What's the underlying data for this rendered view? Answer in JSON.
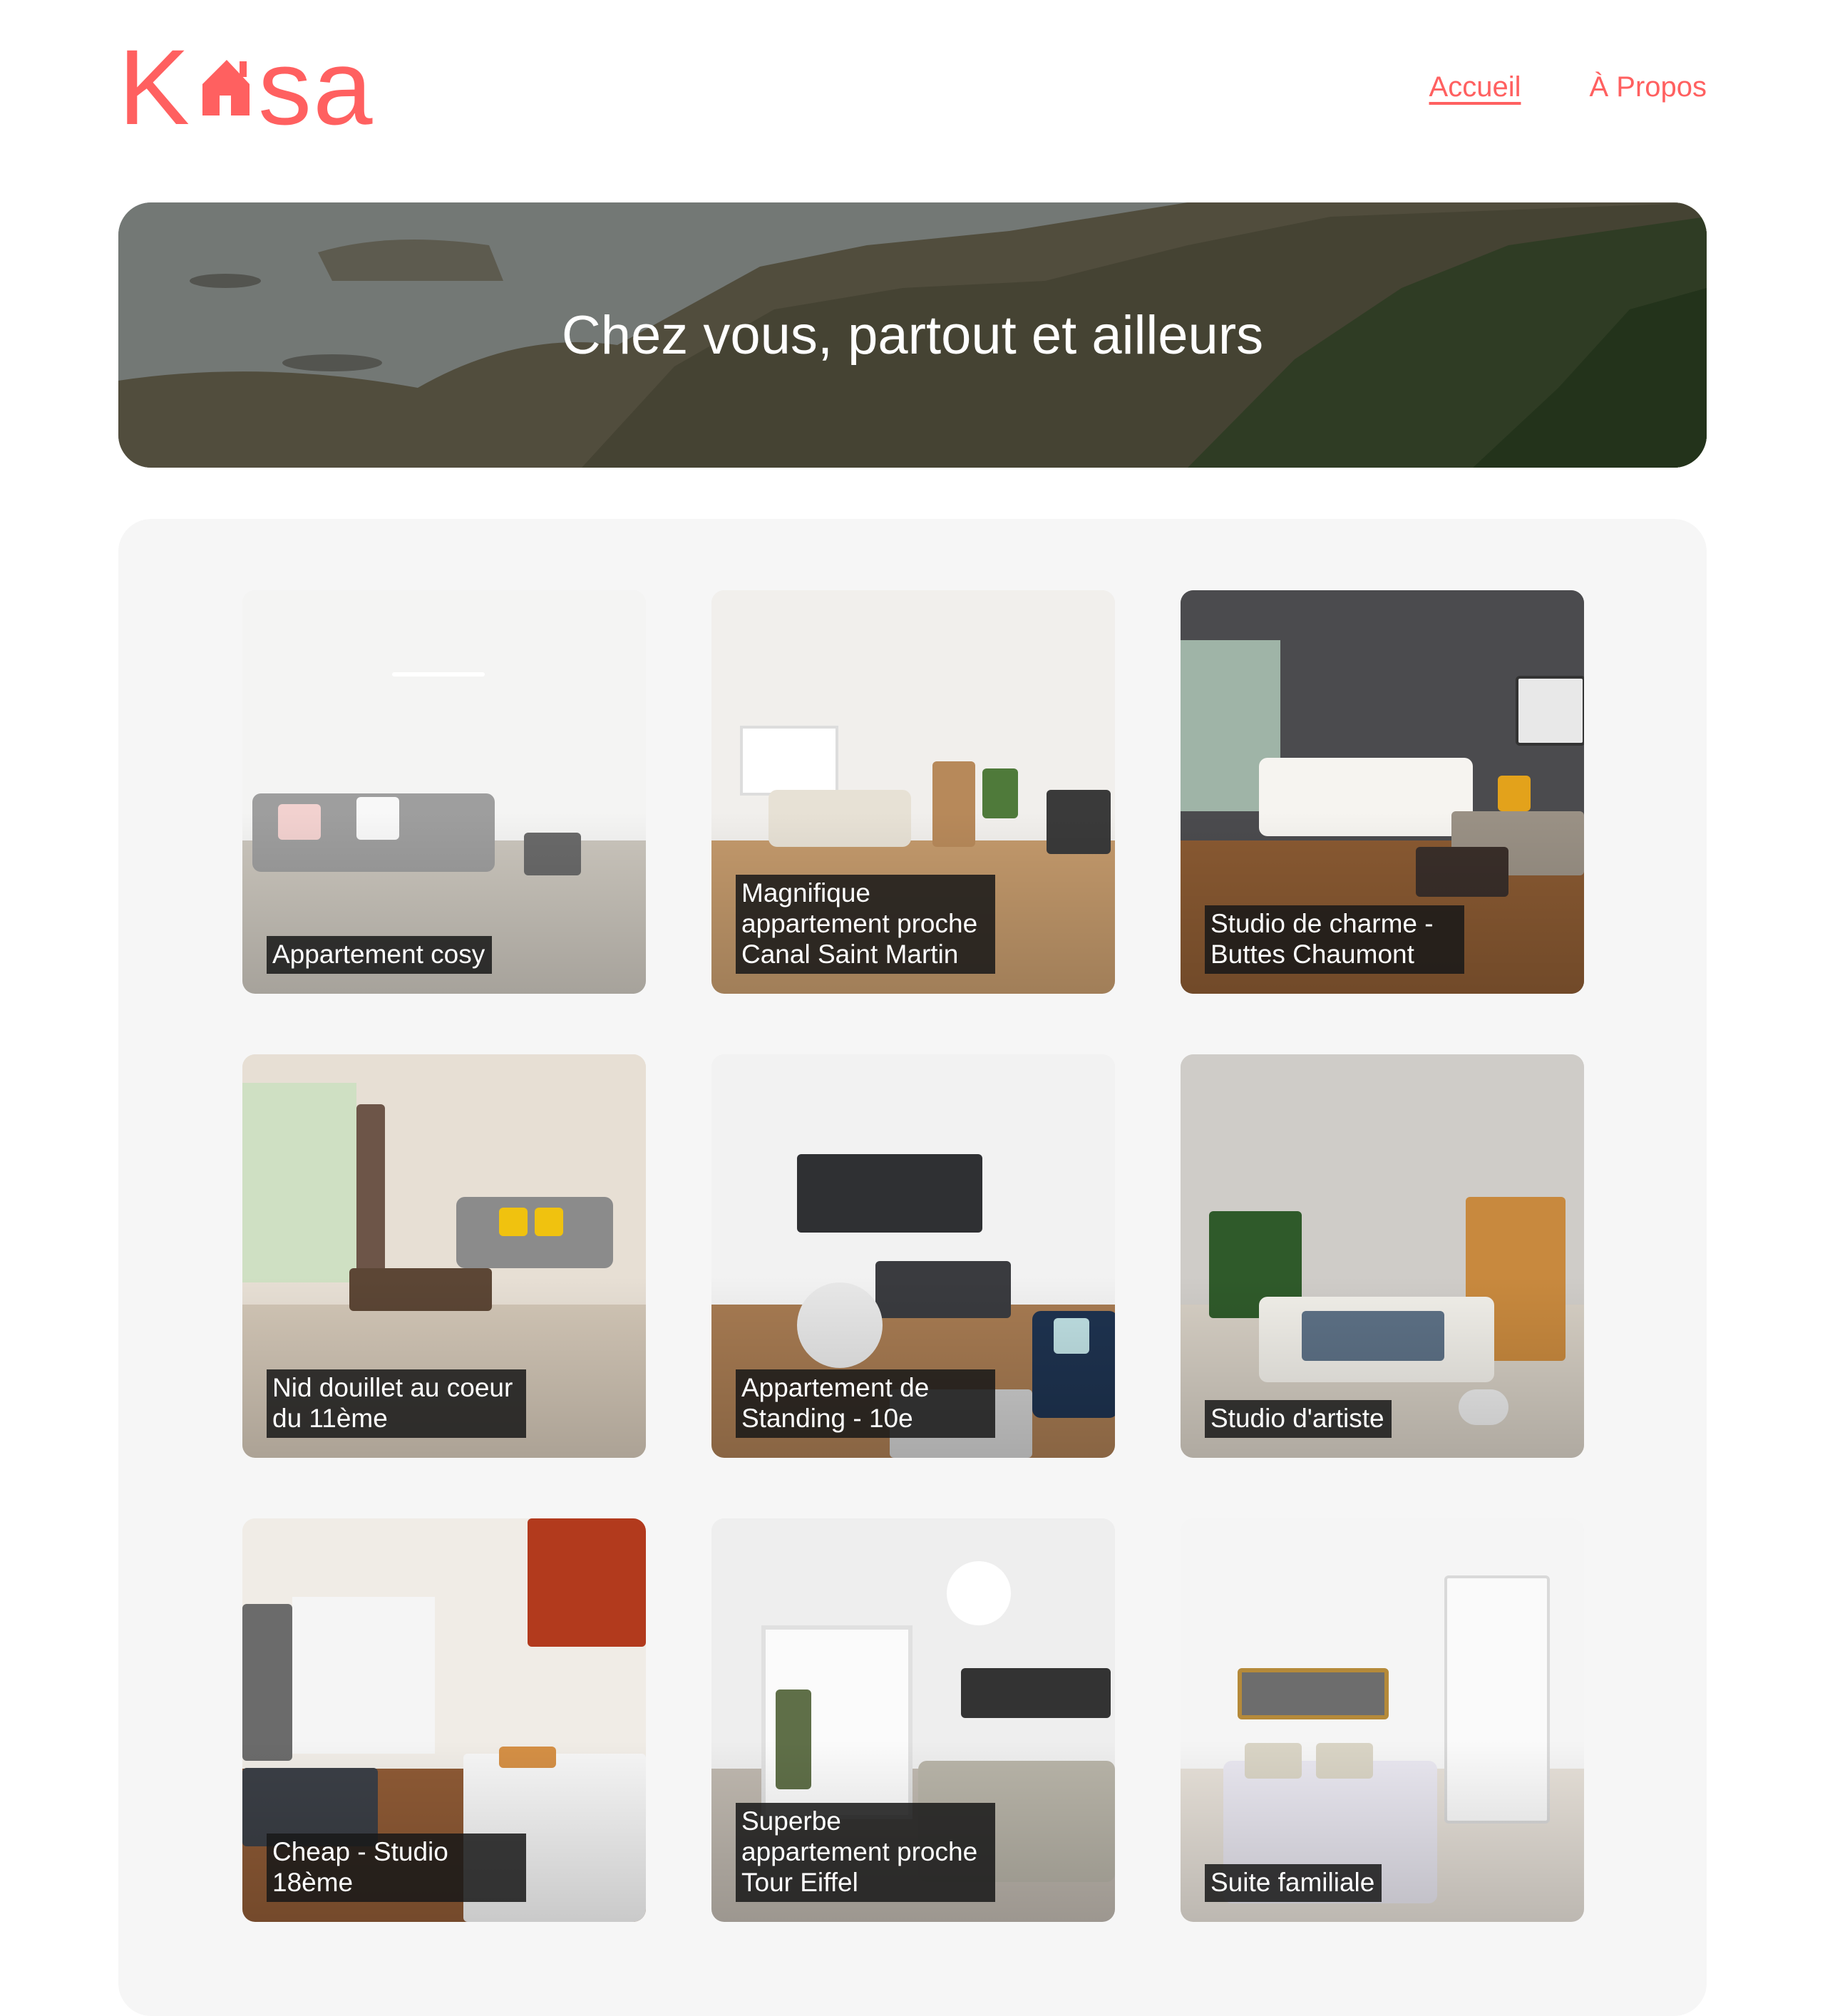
{
  "header": {
    "logo": {
      "letters_left": "K",
      "letters_right": "sa",
      "icon": "house-icon"
    },
    "nav": [
      {
        "label": "Accueil",
        "active": true
      },
      {
        "label": "À Propos",
        "active": false
      }
    ]
  },
  "banner": {
    "title": "Chez vous, partout et ailleurs"
  },
  "gallery": {
    "cards": [
      {
        "title": "Appartement cosy"
      },
      {
        "title": "Magnifique appartement proche Canal Saint Martin"
      },
      {
        "title": "Studio de charme - Buttes Chaumont"
      },
      {
        "title": "Nid douillet au coeur du 11ème"
      },
      {
        "title": "Appartement de Standing - 10e"
      },
      {
        "title": "Studio d'artiste"
      },
      {
        "title": "Cheap - Studio 18ème"
      },
      {
        "title": "Superbe appartement proche Tour Eiffel"
      },
      {
        "title": "Suite familiale"
      }
    ]
  },
  "colors": {
    "brand": "#FF6060",
    "gallery_bg": "#F6F6F6"
  }
}
